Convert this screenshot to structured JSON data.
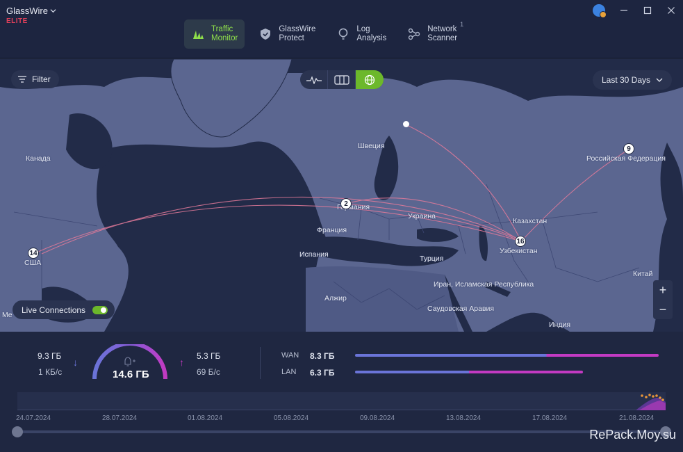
{
  "app": {
    "name": "GlassWire",
    "tier": "ELITE"
  },
  "nav": [
    {
      "id": "traffic-monitor",
      "label": "Traffic\nMonitor",
      "active": true,
      "icon": "traffic-monitor-icon"
    },
    {
      "id": "glasswire-protect",
      "label": "GlassWire\nProtect",
      "active": false,
      "icon": "shield-icon"
    },
    {
      "id": "log-analysis",
      "label": "Log\nAnalysis",
      "active": false,
      "icon": "lightbulb-icon"
    },
    {
      "id": "network-scanner",
      "label": "Network\nScanner",
      "active": false,
      "icon": "network-icon",
      "badge": "1"
    }
  ],
  "map": {
    "filter_label": "Filter",
    "period_label": "Last 30 Days",
    "live_label": "Live Connections",
    "live_on": true,
    "view_modes": [
      "graph-view-icon",
      "split-view-icon",
      "globe-view-icon"
    ],
    "active_view": "globe-view-icon",
    "countries": [
      "Канада",
      "США",
      "Me",
      "Швеция",
      "Германия",
      "Франция",
      "Испания",
      "Украина",
      "Турция",
      "Алжир",
      "Казахстан",
      "Узбекистан",
      "Российская Федерация",
      "Иран, Исламская Республика",
      "Саудовская Аравия",
      "Индия",
      "Китай"
    ],
    "markers": {
      "usa": "14",
      "germany": "2",
      "uzbekistan": "16",
      "russia": "9"
    },
    "zoom_in": "+",
    "zoom_out": "−"
  },
  "stats": {
    "download_total": "9.3 ГБ",
    "download_rate": "1 КБ/с",
    "upload_total": "5.3 ГБ",
    "upload_rate": "69 Б/с",
    "total": "14.6 ГБ",
    "wan_label": "WAN",
    "wan_value": "8.3 ГБ",
    "lan_label": "LAN",
    "lan_value": "6.3 ГБ",
    "wan_download_fraction": 0.63,
    "lan_download_fraction": 0.5
  },
  "timeline": {
    "dates": [
      "24.07.2024",
      "28.07.2024",
      "01.08.2024",
      "05.08.2024",
      "09.08.2024",
      "13.08.2024",
      "17.08.2024",
      "21.08.2024"
    ]
  },
  "watermark": "RePack.Moy.su",
  "colors": {
    "accent_green": "#6cb82b",
    "download": "#6a74d8",
    "upload": "#c23ac2",
    "elite": "#e0405a"
  }
}
